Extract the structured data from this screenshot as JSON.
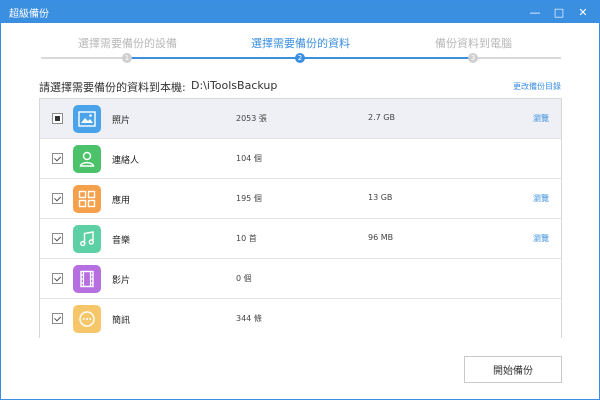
{
  "window": {
    "title": "超級備份",
    "minimize": "—",
    "maximize": "□",
    "close": "✕"
  },
  "stepper": {
    "steps": [
      {
        "label": "選擇需要備份的設備",
        "number": "1"
      },
      {
        "label": "選擇需要備份的資料",
        "number": "2"
      },
      {
        "label": "備份資料到電腦",
        "number": "3"
      }
    ]
  },
  "path": {
    "label": "請選擇需要備份的資料到本機:",
    "value": "D:\\iToolsBackup",
    "change_link": "更改備份目錄"
  },
  "items": [
    {
      "name": "照片",
      "count": "2053 張",
      "size": "2.7 GB",
      "browse": "瀏覽",
      "icon": "photo-icon",
      "color": "#4aa3e8",
      "check": "partial"
    },
    {
      "name": "連絡人",
      "count": "104 個",
      "size": "",
      "browse": "",
      "icon": "contact-icon",
      "color": "#4cc36b",
      "check": "checked"
    },
    {
      "name": "應用",
      "count": "195 個",
      "size": "13 GB",
      "browse": "瀏覽",
      "icon": "apps-icon",
      "color": "#f5a04a",
      "check": "checked"
    },
    {
      "name": "音樂",
      "count": "10 首",
      "size": "96 MB",
      "browse": "瀏覽",
      "icon": "music-icon",
      "color": "#5ed0a6",
      "check": "checked"
    },
    {
      "name": "影片",
      "count": "0 個",
      "size": "",
      "browse": "",
      "icon": "film-icon",
      "color": "#b56fe0",
      "check": "checked"
    },
    {
      "name": "簡訊",
      "count": "344 條",
      "size": "",
      "browse": "",
      "icon": "message-icon",
      "color": "#f5c76a",
      "check": "checked"
    }
  ],
  "start_button": "開始備份"
}
